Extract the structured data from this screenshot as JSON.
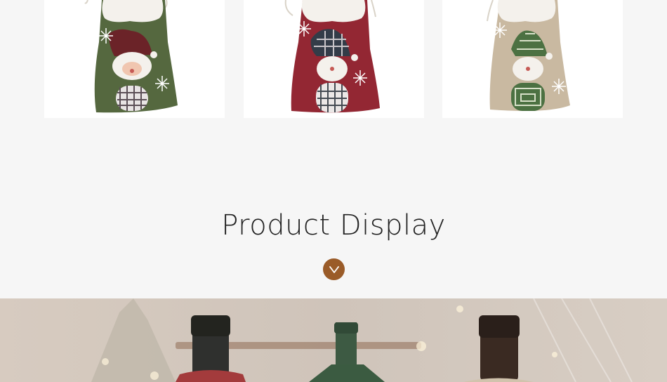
{
  "products": [
    {
      "name": "green-santa-bag",
      "bag_color": "#55683f",
      "hat_color": "#6b2328"
    },
    {
      "name": "red-snowman-bag",
      "bag_color": "#932733",
      "hat_color": "#333c48"
    },
    {
      "name": "burlap-snowman-bag",
      "bag_color": "#c9b9a1",
      "hat_color": "#4c7142"
    }
  ],
  "section": {
    "title": "Product Display",
    "chevron_icon": "chevron-down-icon",
    "accent": "#9a5b28"
  },
  "hero": {
    "image": "wine-bottles-photo"
  }
}
